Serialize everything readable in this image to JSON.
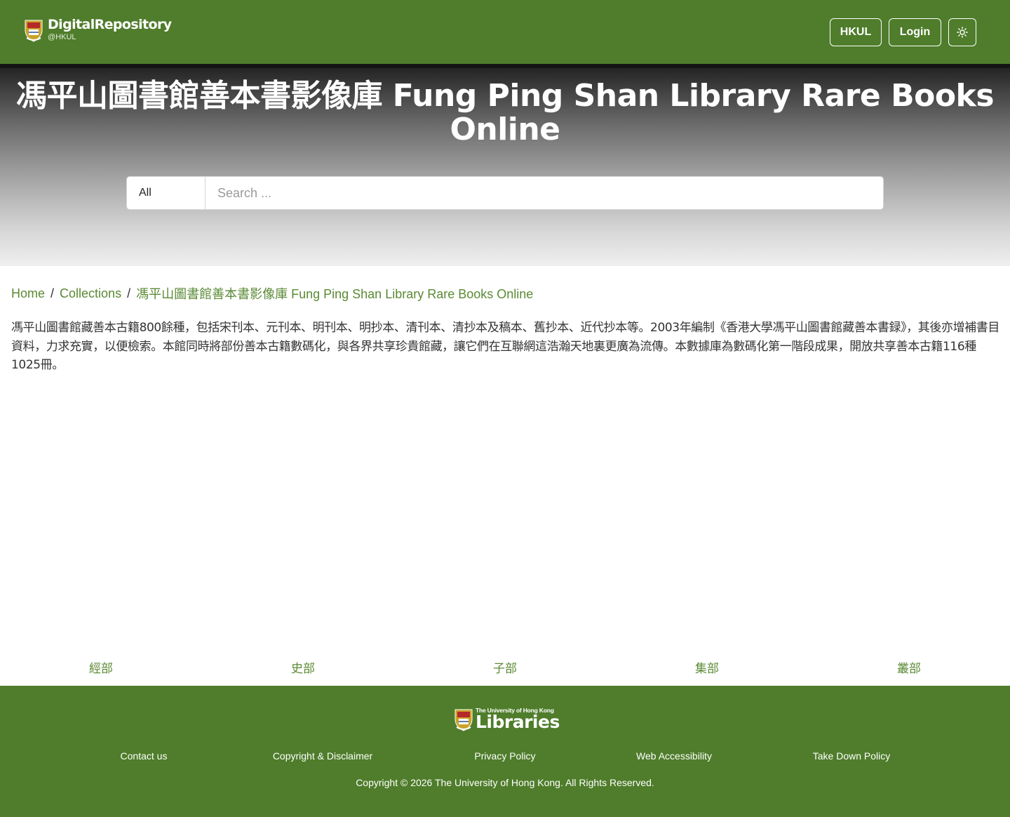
{
  "header": {
    "brand_main": "DigitalRepository",
    "brand_sub": "@HKUL",
    "buttons": {
      "hkul": "HKUL",
      "login": "Login"
    }
  },
  "hero": {
    "title": "馮平山圖書館善本書影像庫 Fung Ping Shan Library Rare Books Online"
  },
  "search": {
    "scope_value": "All",
    "placeholder": "Search ..."
  },
  "breadcrumb": {
    "items": [
      "Home",
      "Collections",
      "馮平山圖書館善本書影像庫 Fung Ping Shan Library Rare Books Online"
    ],
    "separator": "/"
  },
  "description": "馮平山圖書館藏善本古籍800餘種，包括宋刊本、元刊本、明刊本、明抄本、清刊本、清抄本及稿本、舊抄本、近代抄本等。2003年編制《香港大學馮平山圖書館藏善本書録》，其後亦增補書目資料，力求充實，以便檢索。本館同時將部份善本古籍數碼化，與各界共享珍貴館藏，讓它們在互聯網這浩瀚天地裏更廣為流傳。本數據庫為數碼化第一階段成果，開放共享善本古籍116種1025冊。",
  "categories": [
    "經部",
    "史部",
    "子部",
    "集部",
    "叢部"
  ],
  "footer": {
    "logo_small": "The University of Hong Kong",
    "logo_big": "Libraries",
    "links": [
      "Contact us",
      "Copyright & Disclaimer",
      "Privacy Policy",
      "Web Accessibility",
      "Take Down Policy"
    ],
    "copyright": "Copyright © 2026 The University of Hong Kong. All Rights Reserved."
  },
  "colors": {
    "brand_green": "#4f7d2b",
    "link_green": "#5a8a34",
    "text": "#333333"
  },
  "icons": {
    "theme_toggle": "sun-icon",
    "logo": "hku-crest-icon"
  }
}
